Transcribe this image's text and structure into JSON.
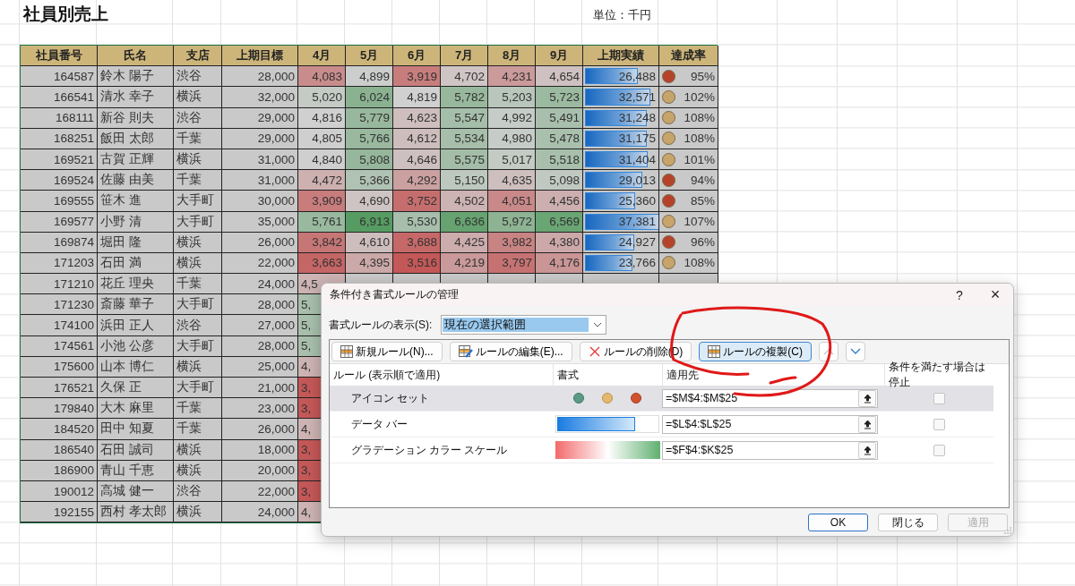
{
  "sheet": {
    "title": "社員別売上",
    "unit": "単位：千円"
  },
  "table": {
    "columns": [
      "社員番号",
      "氏名",
      "支店",
      "上期目標",
      "4月",
      "5月",
      "6月",
      "7月",
      "8月",
      "9月",
      "上期実績",
      "達成率"
    ],
    "rows": [
      {
        "id": "164587",
        "name": "鈴木 陽子",
        "branch": "渋谷",
        "target": "28,000",
        "months": [
          "4,083",
          "4,899",
          "3,919",
          "4,702",
          "4,231",
          "4,654"
        ],
        "total": "26,488",
        "level": 0.7,
        "rate": "95%",
        "color": "#b5432a"
      },
      {
        "id": "166541",
        "name": "清水 幸子",
        "branch": "横浜",
        "target": "32,000",
        "months": [
          "5,020",
          "6,024",
          "4,819",
          "5,782",
          "5,203",
          "5,723"
        ],
        "total": "32,571",
        "level": 0.87,
        "rate": "102%",
        "color": "#c7a46a"
      },
      {
        "id": "168111",
        "name": "新谷 則夫",
        "branch": "渋谷",
        "target": "29,000",
        "months": [
          "4,816",
          "5,779",
          "4,623",
          "5,547",
          "4,992",
          "5,491"
        ],
        "total": "31,248",
        "level": 0.82,
        "rate": "108%",
        "color": "#c7a46a"
      },
      {
        "id": "168251",
        "name": "飯田 太郎",
        "branch": "千葉",
        "target": "29,000",
        "months": [
          "4,805",
          "5,766",
          "4,612",
          "5,534",
          "4,980",
          "5,478"
        ],
        "total": "31,175",
        "level": 0.82,
        "rate": "108%",
        "color": "#c7a46a"
      },
      {
        "id": "169521",
        "name": "古賀 正輝",
        "branch": "横浜",
        "target": "31,000",
        "months": [
          "4,840",
          "5,808",
          "4,646",
          "5,575",
          "5,017",
          "5,518"
        ],
        "total": "31,404",
        "level": 0.83,
        "rate": "101%",
        "color": "#c7a46a"
      },
      {
        "id": "169524",
        "name": "佐藤 由美",
        "branch": "千葉",
        "target": "31,000",
        "months": [
          "4,472",
          "5,366",
          "4,292",
          "5,150",
          "4,635",
          "5,098"
        ],
        "total": "29,013",
        "level": 0.76,
        "rate": "94%",
        "color": "#b5432a"
      },
      {
        "id": "169555",
        "name": "笹木 進",
        "branch": "大手町",
        "target": "30,000",
        "months": [
          "3,909",
          "4,690",
          "3,752",
          "4,502",
          "4,051",
          "4,456"
        ],
        "total": "25,360",
        "level": 0.67,
        "rate": "85%",
        "color": "#b5432a"
      },
      {
        "id": "169577",
        "name": "小野 清",
        "branch": "大手町",
        "target": "35,000",
        "months": [
          "5,761",
          "6,913",
          "5,530",
          "6,636",
          "5,972",
          "6,569"
        ],
        "total": "37,381",
        "level": 0.99,
        "rate": "107%",
        "color": "#c7a46a"
      },
      {
        "id": "169874",
        "name": "堀田 隆",
        "branch": "横浜",
        "target": "26,000",
        "months": [
          "3,842",
          "4,610",
          "3,688",
          "4,425",
          "3,982",
          "4,380"
        ],
        "total": "24,927",
        "level": 0.66,
        "rate": "96%",
        "color": "#b5432a"
      },
      {
        "id": "171203",
        "name": "石田 満",
        "branch": "横浜",
        "target": "22,000",
        "months": [
          "3,663",
          "4,395",
          "3,516",
          "4,219",
          "3,797",
          "4,176"
        ],
        "total": "23,766",
        "level": 0.63,
        "rate": "108%",
        "color": "#c7a46a"
      },
      {
        "id": "171210",
        "name": "花丘 理央",
        "branch": "千葉",
        "target": "24,000",
        "partial": "4,5"
      },
      {
        "id": "171230",
        "name": "斎藤 華子",
        "branch": "大手町",
        "target": "28,000",
        "partial": "5,"
      },
      {
        "id": "174100",
        "name": "浜田 正人",
        "branch": "渋谷",
        "target": "27,000",
        "partial": "5,"
      },
      {
        "id": "174561",
        "name": "小池 公彦",
        "branch": "大手町",
        "target": "28,000",
        "partial": "5,"
      },
      {
        "id": "175600",
        "name": "山本 博仁",
        "branch": "横浜",
        "target": "25,000",
        "partial": "4,"
      },
      {
        "id": "176521",
        "name": "久保 正",
        "branch": "大手町",
        "target": "21,000",
        "partial": "3,"
      },
      {
        "id": "179840",
        "name": "大木 麻里",
        "branch": "千葉",
        "target": "23,000",
        "partial": "3,"
      },
      {
        "id": "184520",
        "name": "田中 知夏",
        "branch": "千葉",
        "target": "26,000",
        "partial": "4,"
      },
      {
        "id": "186540",
        "name": "石田 誠司",
        "branch": "横浜",
        "target": "18,000",
        "partial": "3,"
      },
      {
        "id": "186900",
        "name": "青山 千恵",
        "branch": "横浜",
        "target": "20,000",
        "partial": "3,"
      },
      {
        "id": "190012",
        "name": "高城 健一",
        "branch": "渋谷",
        "target": "22,000",
        "partial": "3,"
      },
      {
        "id": "192155",
        "name": "西村 孝太郎",
        "branch": "横浜",
        "target": "24,000",
        "partial": "4,"
      }
    ]
  },
  "dialog": {
    "title": "条件付き書式ルールの管理",
    "help": "?",
    "close": "×",
    "show_label": "書式ルールの表示(S):",
    "show_value": "現在の選択範囲",
    "toolbar": [
      {
        "kind": "new",
        "label": "新規ルール(N)...",
        "focused": false
      },
      {
        "kind": "edit",
        "label": "ルールの編集(E)...",
        "focused": false
      },
      {
        "kind": "delete",
        "label": "ルールの削除(D)",
        "focused": false
      },
      {
        "kind": "duplicate",
        "label": "ルールの複製(C)",
        "focused": true
      },
      {
        "kind": "up",
        "disabled": true
      },
      {
        "kind": "down",
        "disabled": false
      }
    ],
    "columns": [
      "ルール (表示順で適用)",
      "書式",
      "適用先",
      "条件を満たす場合は停止"
    ],
    "rules": [
      {
        "kind": "icons",
        "name": "アイコン セット",
        "applies_to": "=$M$4:$M$25",
        "stop": false,
        "selected": true
      },
      {
        "kind": "databar",
        "name": "データ バー",
        "applies_to": "=$L$4:$L$25",
        "stop": false,
        "selected": false
      },
      {
        "kind": "colorscale",
        "name": "グラデーション カラー スケール",
        "applies_to": "=$F$4:$K$25",
        "stop": false,
        "selected": false
      }
    ],
    "buttons": [
      {
        "label": "OK",
        "default": true,
        "disabled": false
      },
      {
        "label": "閉じる",
        "default": false,
        "disabled": false
      },
      {
        "label": "適用",
        "default": false,
        "disabled": true
      }
    ]
  }
}
